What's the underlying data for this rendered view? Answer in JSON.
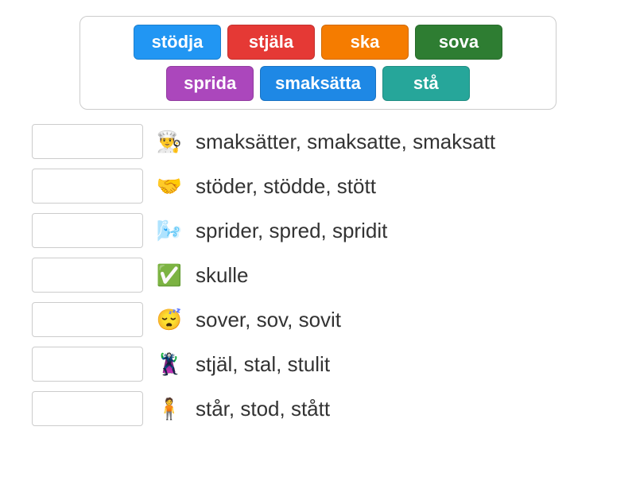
{
  "word_bank": [
    {
      "label": "stödja",
      "color": "#2196F3"
    },
    {
      "label": "stjäla",
      "color": "#E53935"
    },
    {
      "label": "ska",
      "color": "#F57C00"
    },
    {
      "label": "sova",
      "color": "#2E7D32"
    },
    {
      "label": "sprida",
      "color": "#AB47BC"
    },
    {
      "label": "smaksätta",
      "color": "#1E88E5"
    },
    {
      "label": "stå",
      "color": "#26A69A"
    }
  ],
  "questions": [
    {
      "emoji": "👨‍🍳",
      "text": "smaksätter, smaksatte, smaksatt"
    },
    {
      "emoji": "🤝",
      "text": "stöder, stödde, stött"
    },
    {
      "emoji": "🌬️",
      "text": "sprider, spred, spridit"
    },
    {
      "emoji": "✅",
      "text": "skulle"
    },
    {
      "emoji": "😴",
      "text": "sover, sov, sovit"
    },
    {
      "emoji": "🦹",
      "text": "stjäl, stal, stulit"
    },
    {
      "emoji": "🧍",
      "text": "står, stod, stått"
    }
  ]
}
